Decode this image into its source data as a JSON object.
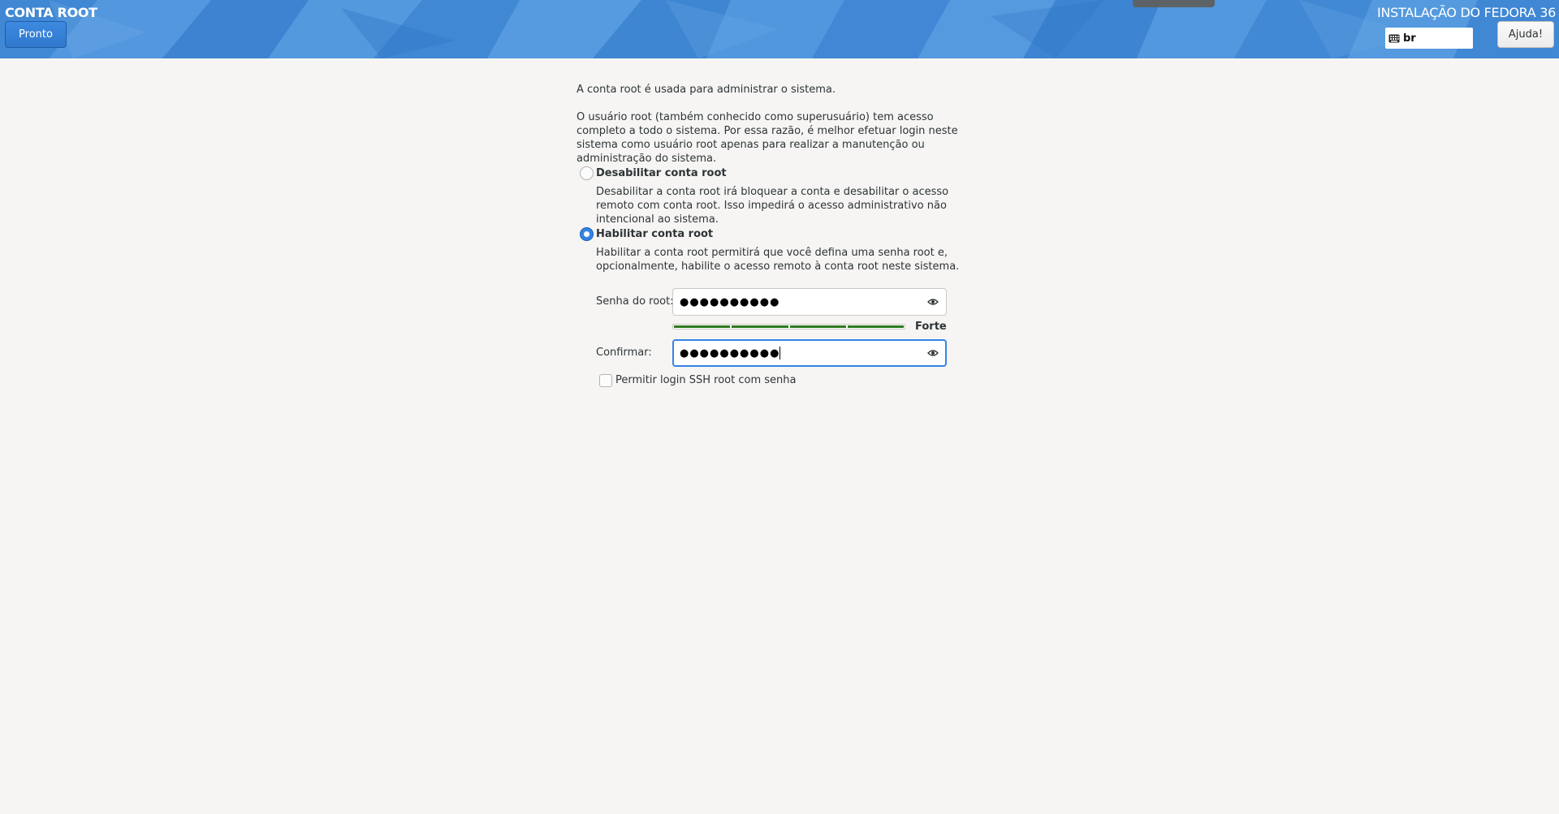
{
  "header": {
    "spoke_title": "CONTA ROOT",
    "done_button": "Pronto",
    "product_title": "INSTALAÇÃO DO FEDORA 36",
    "keyboard_layout": "br",
    "help_button": "Ajuda!",
    "colors": {
      "background": "#4a90d9",
      "done_button": "#3584e4"
    }
  },
  "intro": {
    "line1": "A conta root é usada para administrar o sistema.",
    "line2": "O usuário root (também conhecido como superusuário) tem acesso completo a todo o sistema. Por essa razão, é melhor efetuar login neste sistema como usuário root apenas para realizar a manutenção ou administração do sistema."
  },
  "options": {
    "disable": {
      "label": "Desabilitar conta root",
      "description": "Desabilitar a conta root irá bloquear a conta e desabilitar o acesso remoto com conta root. Isso impedirá o acesso administrativo não intencional ao sistema.",
      "selected": false
    },
    "enable": {
      "label": "Habilitar conta root",
      "description": "Habilitar a conta root permitirá que você defina uma senha root e, opcionalmente, habilite o acesso remoto à conta root neste sistema.",
      "selected": true
    }
  },
  "password": {
    "label": "Senha do root:",
    "value": "●●●●●●●●●●",
    "icon": "eye-icon"
  },
  "strength": {
    "label": "Forte",
    "level": 1.0,
    "segments": 4,
    "color": "#2c7a1e"
  },
  "confirm": {
    "label": "Confirmar:",
    "value": "●●●●●●●●●●",
    "icon": "eye-icon"
  },
  "ssh": {
    "label": "Permitir login SSH root com senha",
    "checked": false
  }
}
